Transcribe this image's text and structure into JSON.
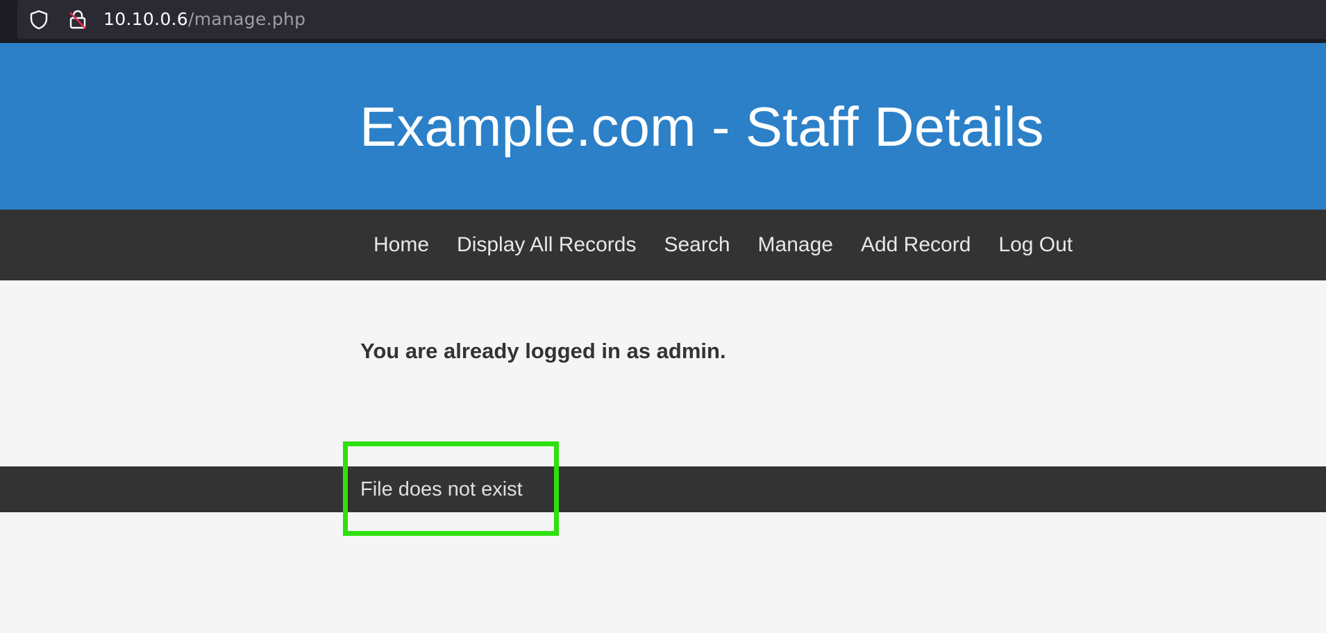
{
  "browser": {
    "url_host": "10.10.0.6",
    "url_path": "/manage.php"
  },
  "header": {
    "title": "Example.com - Staff Details"
  },
  "nav": {
    "items": [
      {
        "label": "Home"
      },
      {
        "label": "Display All Records"
      },
      {
        "label": "Search"
      },
      {
        "label": "Manage"
      },
      {
        "label": "Add Record"
      },
      {
        "label": "Log Out"
      }
    ]
  },
  "main": {
    "login_message": "You are already logged in as admin."
  },
  "footer": {
    "message": "File does not exist"
  },
  "colors": {
    "header_bg": "#2b80c8",
    "nav_bg": "#333333",
    "page_bg": "#f5f5f5",
    "highlight": "#2ee010"
  }
}
